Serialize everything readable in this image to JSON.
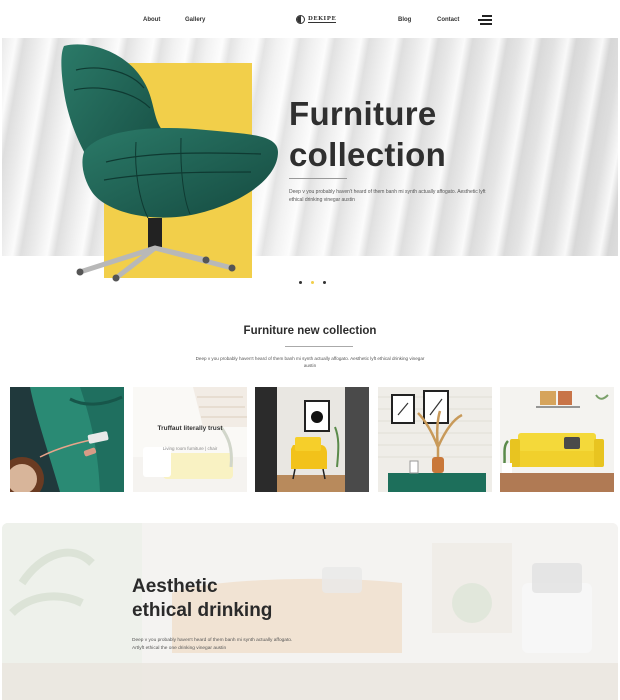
{
  "nav": {
    "about": "About",
    "gallery": "Gallery",
    "logo_text": "DEKIPE",
    "blog": "Blog",
    "contact": "Contact",
    "menu_icon": "hamburger-menu-icon"
  },
  "hero": {
    "title_line1": "Furniture",
    "title_line2": "collection",
    "description": "Deep v you probably haven't heard of them banh mi synth actually affogato. Aesthetic lyft ethical drinking vinegar austin",
    "accent_color": "#f2cf4a",
    "chair_color": "#1d5a4e",
    "slides": 3,
    "active_slide": 2
  },
  "collection": {
    "title": "Furniture new collection",
    "description": "Deep v you probably haven't heard of them banh mi synth actually affogato. Aesthetic lyft ethical drinking vinegar austin",
    "tiles": [
      {
        "name": "green-sofa-tile"
      },
      {
        "name": "truffaut-tile",
        "title": "Truffaut literally trust",
        "subtitle": "Living room furniture | chair"
      },
      {
        "name": "yellow-armchair-tile"
      },
      {
        "name": "green-cabinet-tile"
      },
      {
        "name": "yellow-sofa-tile"
      }
    ]
  },
  "feature": {
    "title_line1": "Aesthetic",
    "title_line2": "ethical drinking",
    "description": "Deep v you probably haven't heard of them banh mi synth actually affogato. Artlyft ethical the one drinking vinegar austin"
  }
}
